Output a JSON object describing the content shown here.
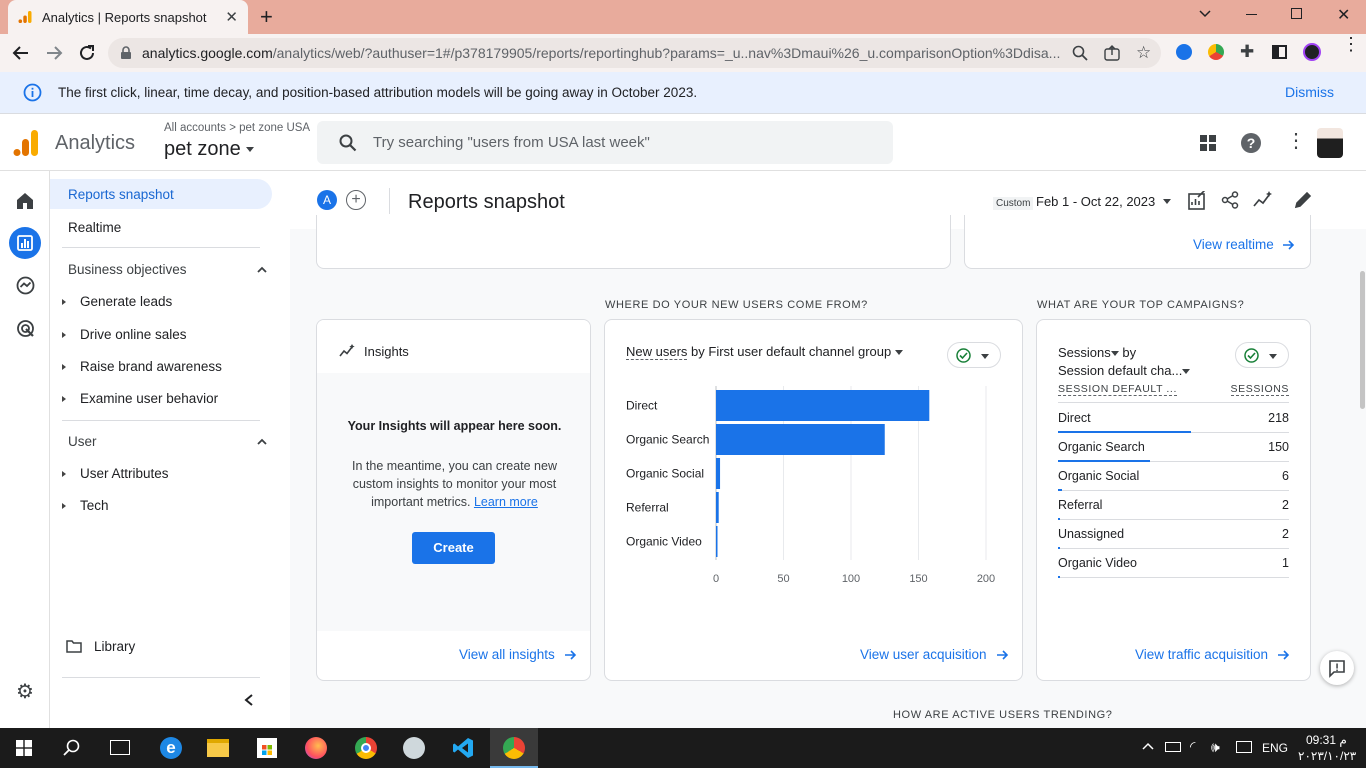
{
  "browser": {
    "tab_title": "Analytics | Reports snapshot",
    "url_host": "analytics.google.com",
    "url_rest": "/analytics/web/?authuser=1#/p378179905/reports/reportinghub?params=_u..nav%3Dmaui%26_u.comparisonOption%3Ddisa..."
  },
  "banner": {
    "message": "The first click, linear, time decay, and position-based attribution models will be going away in October 2023.",
    "dismiss": "Dismiss"
  },
  "ga_header": {
    "app_name": "Analytics",
    "breadcrumb_all": "All accounts",
    "breadcrumb_account": "pet zone USA",
    "property": "pet zone",
    "search_placeholder": "Try searching \"users from USA last week\""
  },
  "nav": {
    "reports_snapshot": "Reports snapshot",
    "realtime": "Realtime",
    "business_objectives": "Business objectives",
    "objectives": [
      "Generate leads",
      "Drive online sales",
      "Raise brand awareness",
      "Examine user behavior"
    ],
    "user_section": "User",
    "user_items": [
      "User Attributes",
      "Tech"
    ],
    "library": "Library"
  },
  "page_header": {
    "avatar_letter": "A",
    "title": "Reports snapshot",
    "date_custom": "Custom",
    "date_range": "Feb 1 - Oct 22, 2023"
  },
  "main": {
    "view_realtime": "View realtime",
    "new_users_section": "WHERE DO YOUR NEW USERS COME FROM?",
    "campaigns_section": "WHAT ARE YOUR TOP CAMPAIGNS?",
    "trend_section": "HOW ARE ACTIVE USERS TRENDING?",
    "insights": {
      "title": "Insights",
      "heading": "Your Insights will appear here soon.",
      "body_line1": "In the meantime, you can create new",
      "body_line2": "custom insights to monitor your most",
      "body_line3": "important metrics.",
      "learn_more": "Learn more",
      "create": "Create",
      "view_all": "View all insights"
    },
    "acquisition": {
      "metric": "New users",
      "by_dimension": "by First user default channel group",
      "view_link": "View user acquisition"
    },
    "campaigns": {
      "metric_line1": "Sessions",
      "metric_by": "by",
      "metric_line2": "Session default cha...",
      "col_dimension": "SESSION DEFAULT ...",
      "col_sessions": "SESSIONS",
      "rows": [
        {
          "label": "Direct",
          "value": "218",
          "share": 1.0
        },
        {
          "label": "Organic Search",
          "value": "150",
          "share": 0.688
        },
        {
          "label": "Organic Social",
          "value": "6",
          "share": 0.03
        },
        {
          "label": "Referral",
          "value": "2",
          "share": 0.01
        },
        {
          "label": "Unassigned",
          "value": "2",
          "share": 0.01
        },
        {
          "label": "Organic Video",
          "value": "1",
          "share": 0.005
        }
      ],
      "view_link": "View traffic acquisition"
    }
  },
  "chart_data": {
    "type": "bar",
    "orientation": "horizontal",
    "categories": [
      "Direct",
      "Organic Search",
      "Organic Social",
      "Referral",
      "Organic Video"
    ],
    "values": [
      158,
      125,
      3,
      2,
      1
    ],
    "xlim": [
      0,
      200
    ],
    "xticks": [
      0,
      50,
      100,
      150,
      200
    ],
    "xtick_labels": [
      "0",
      "50",
      "100",
      "150",
      "200"
    ],
    "grid": true,
    "bar_color": "#1a73e8"
  },
  "taskbar": {
    "lang": "ENG",
    "time": "09:31 م",
    "date": "٢٠٢٣/١٠/٢٣"
  },
  "colors": {
    "accent": "#1a73e8",
    "ga_orange": "#f9ab00",
    "ga_orange_dark": "#e37400",
    "tab_strip": "#e8ab9c"
  }
}
